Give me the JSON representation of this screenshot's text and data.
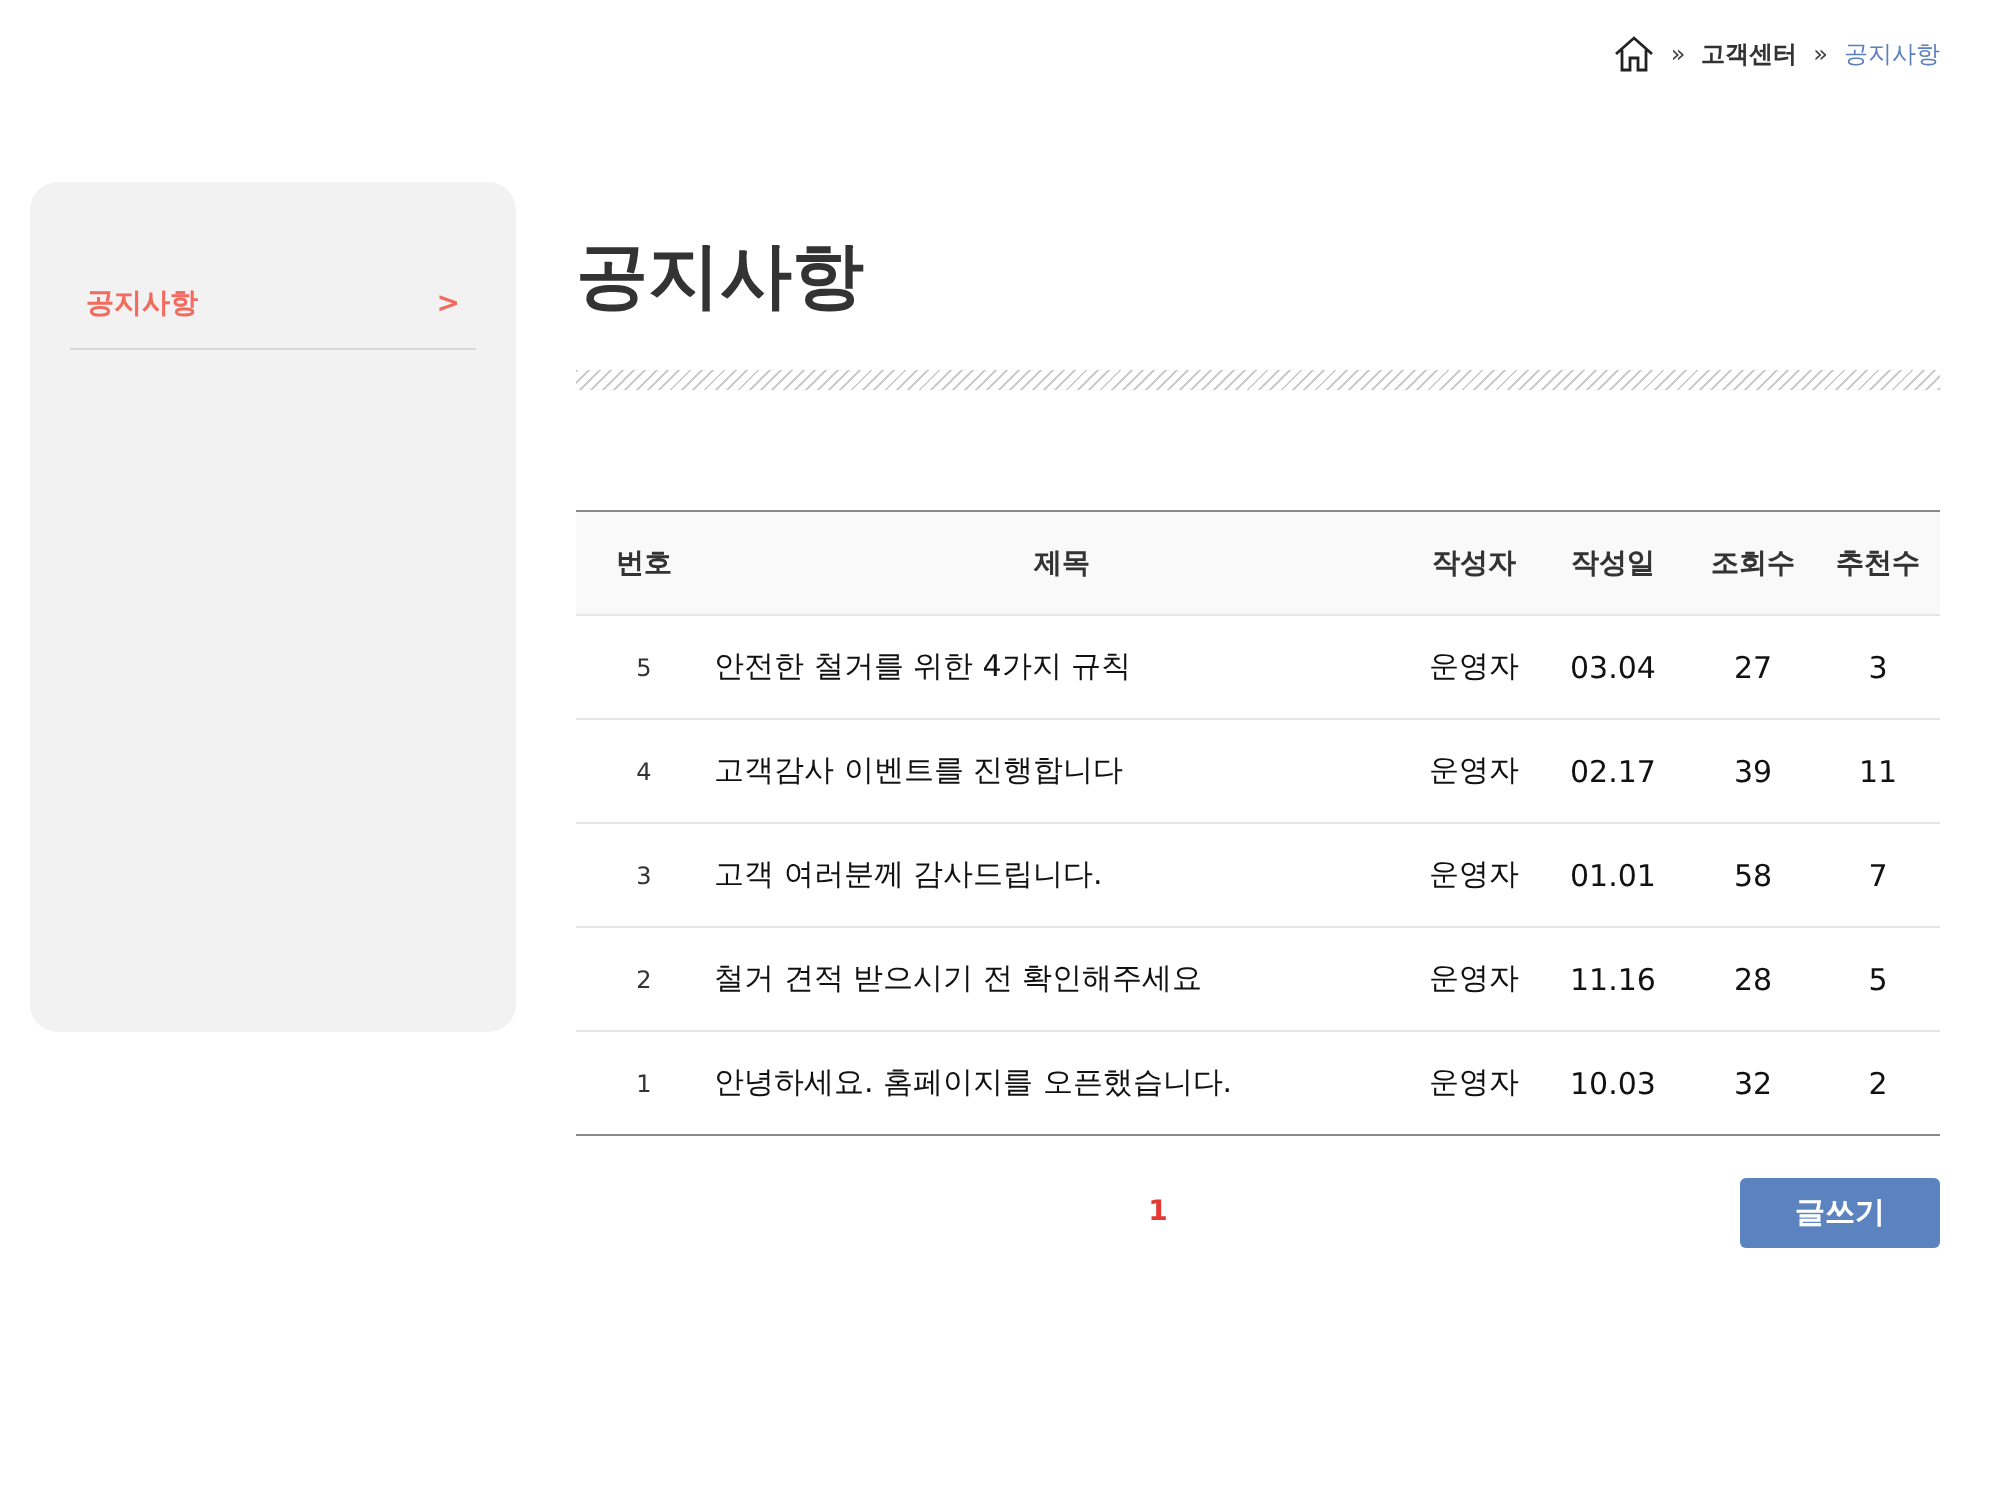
{
  "breadcrumb": {
    "separator": "»",
    "items": [
      {
        "kind": "home"
      },
      {
        "kind": "link",
        "label": "고객센터",
        "selected": false
      },
      {
        "kind": "link",
        "label": "공지사항",
        "selected": true
      }
    ]
  },
  "sidebar": {
    "items": [
      {
        "label": "공지사항",
        "arrow": ">",
        "selected": true
      }
    ]
  },
  "page_title": "공지사항",
  "table": {
    "columns": [
      "번호",
      "제목",
      "작성자",
      "작성일",
      "조회수",
      "추천수"
    ],
    "rows": [
      [
        "5",
        "안전한 철거를 위한 4가지 규칙",
        "운영자",
        "03.04",
        "27",
        "3"
      ],
      [
        "4",
        "고객감사 이벤트를 진행합니다",
        "운영자",
        "02.17",
        "39",
        "11"
      ],
      [
        "3",
        "고객 여러분께 감사드립니다.",
        "운영자",
        "01.01",
        "58",
        "7"
      ],
      [
        "2",
        "철거 견적 받으시기 전 확인해주세요",
        "운영자",
        "11.16",
        "28",
        "5"
      ],
      [
        "1",
        "안녕하세요. 홈페이지를 오픈했습니다.",
        "운영자",
        "10.03",
        "32",
        "2"
      ]
    ]
  },
  "pagination": [
    {
      "label": "1",
      "selected": true
    }
  ],
  "write_button": "글쓰기"
}
